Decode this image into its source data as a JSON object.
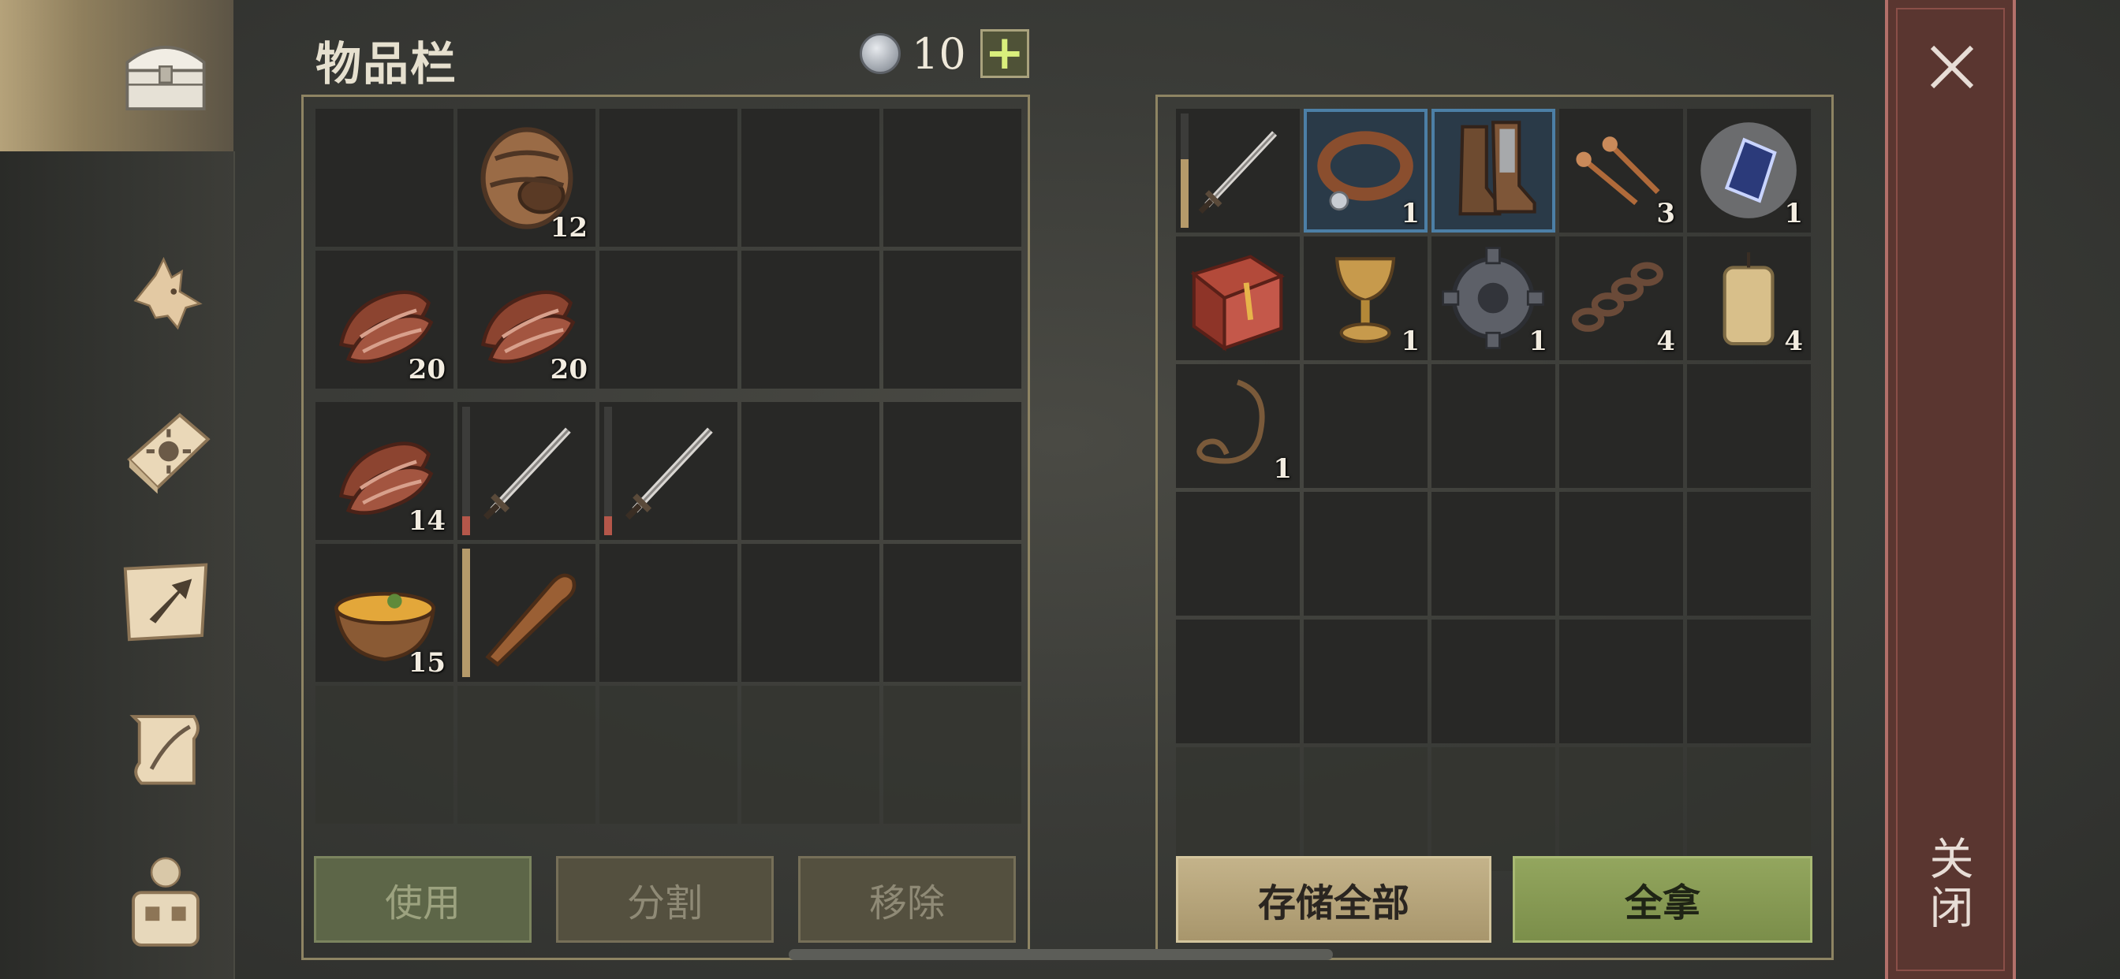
{
  "header": {
    "title": "物品栏",
    "currency_value": "10",
    "plus_label": "+"
  },
  "sidebar": {
    "icons": [
      "chest-icon",
      "wolf-icon",
      "sun-book-icon",
      "map-arrow-icon",
      "scroll-quill-icon",
      "backpack-character-icon"
    ]
  },
  "inventory": {
    "rows": [
      [
        {
          "item": ""
        },
        {
          "item": "barrel",
          "count": "12"
        },
        {
          "item": ""
        },
        {
          "item": ""
        },
        {
          "item": ""
        }
      ],
      [
        {
          "item": "meat",
          "count": "20"
        },
        {
          "item": "meat",
          "count": "20"
        },
        {
          "item": ""
        },
        {
          "item": ""
        },
        {
          "item": ""
        }
      ],
      [
        {
          "item": "meat",
          "count": "14"
        },
        {
          "item": "sword",
          "durability": 0.15
        },
        {
          "item": "sword",
          "durability": 0.15
        },
        {
          "item": ""
        },
        {
          "item": ""
        }
      ],
      [
        {
          "item": "soup",
          "count": "15"
        },
        {
          "item": "club",
          "durability": 1.0
        },
        {
          "item": ""
        },
        {
          "item": ""
        },
        {
          "item": ""
        }
      ],
      [
        {
          "item": ""
        },
        {
          "item": ""
        },
        {
          "item": ""
        },
        {
          "item": ""
        },
        {
          "item": ""
        }
      ]
    ]
  },
  "storage": {
    "rows": [
      [
        {
          "item": "sword",
          "durability": 0.6
        },
        {
          "item": "collar",
          "count": "1",
          "highlight": true
        },
        {
          "item": "boots",
          "highlight": true
        },
        {
          "item": "nails",
          "count": "3"
        },
        {
          "item": "crystal",
          "count": "1"
        }
      ],
      [
        {
          "item": "book"
        },
        {
          "item": "goblet",
          "count": "1"
        },
        {
          "item": "gear",
          "count": "1"
        },
        {
          "item": "chain",
          "count": "4"
        },
        {
          "item": "candle",
          "count": "4"
        }
      ],
      [
        {
          "item": "rope",
          "count": "1"
        },
        {
          "item": ""
        },
        {
          "item": ""
        },
        {
          "item": ""
        },
        {
          "item": ""
        }
      ],
      [
        {
          "item": ""
        },
        {
          "item": ""
        },
        {
          "item": ""
        },
        {
          "item": ""
        },
        {
          "item": ""
        }
      ],
      [
        {
          "item": ""
        },
        {
          "item": ""
        },
        {
          "item": ""
        },
        {
          "item": ""
        },
        {
          "item": ""
        }
      ],
      [
        {
          "item": ""
        },
        {
          "item": ""
        },
        {
          "item": ""
        },
        {
          "item": ""
        },
        {
          "item": ""
        }
      ]
    ]
  },
  "buttons": {
    "use": "使用",
    "split": "分割",
    "remove": "移除",
    "store_all": "存储全部",
    "take_all": "全拿"
  },
  "close": {
    "label": "关闭"
  },
  "colors": {
    "accent_gold": "#c4b38a",
    "accent_green": "#93a65e",
    "close_red": "#5a3630",
    "slot_highlight": "#4c7fa6"
  }
}
